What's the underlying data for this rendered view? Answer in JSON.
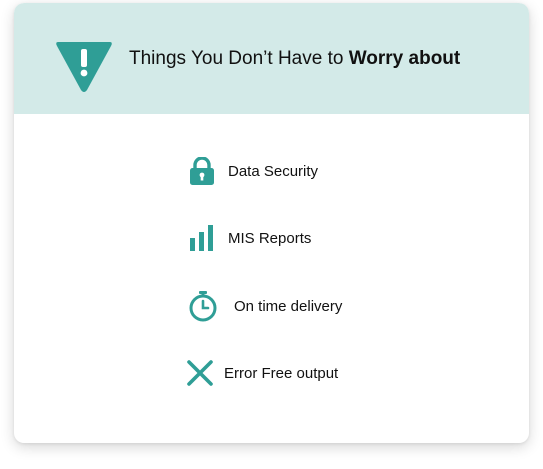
{
  "header": {
    "title_regular": "Things You Don’t Have to ",
    "title_bold": "Worry about"
  },
  "features": [
    {
      "label": "Data Security",
      "icon": "lock-icon"
    },
    {
      "label": "MIS Reports",
      "icon": "bar-chart-icon"
    },
    {
      "label": "On time delivery",
      "icon": "stopwatch-icon"
    },
    {
      "label": "Error Free output",
      "icon": "x-mark-icon"
    }
  ],
  "colors": {
    "accent": "#2f9e96",
    "header_bg": "#d3eae8",
    "text": "#111111"
  }
}
